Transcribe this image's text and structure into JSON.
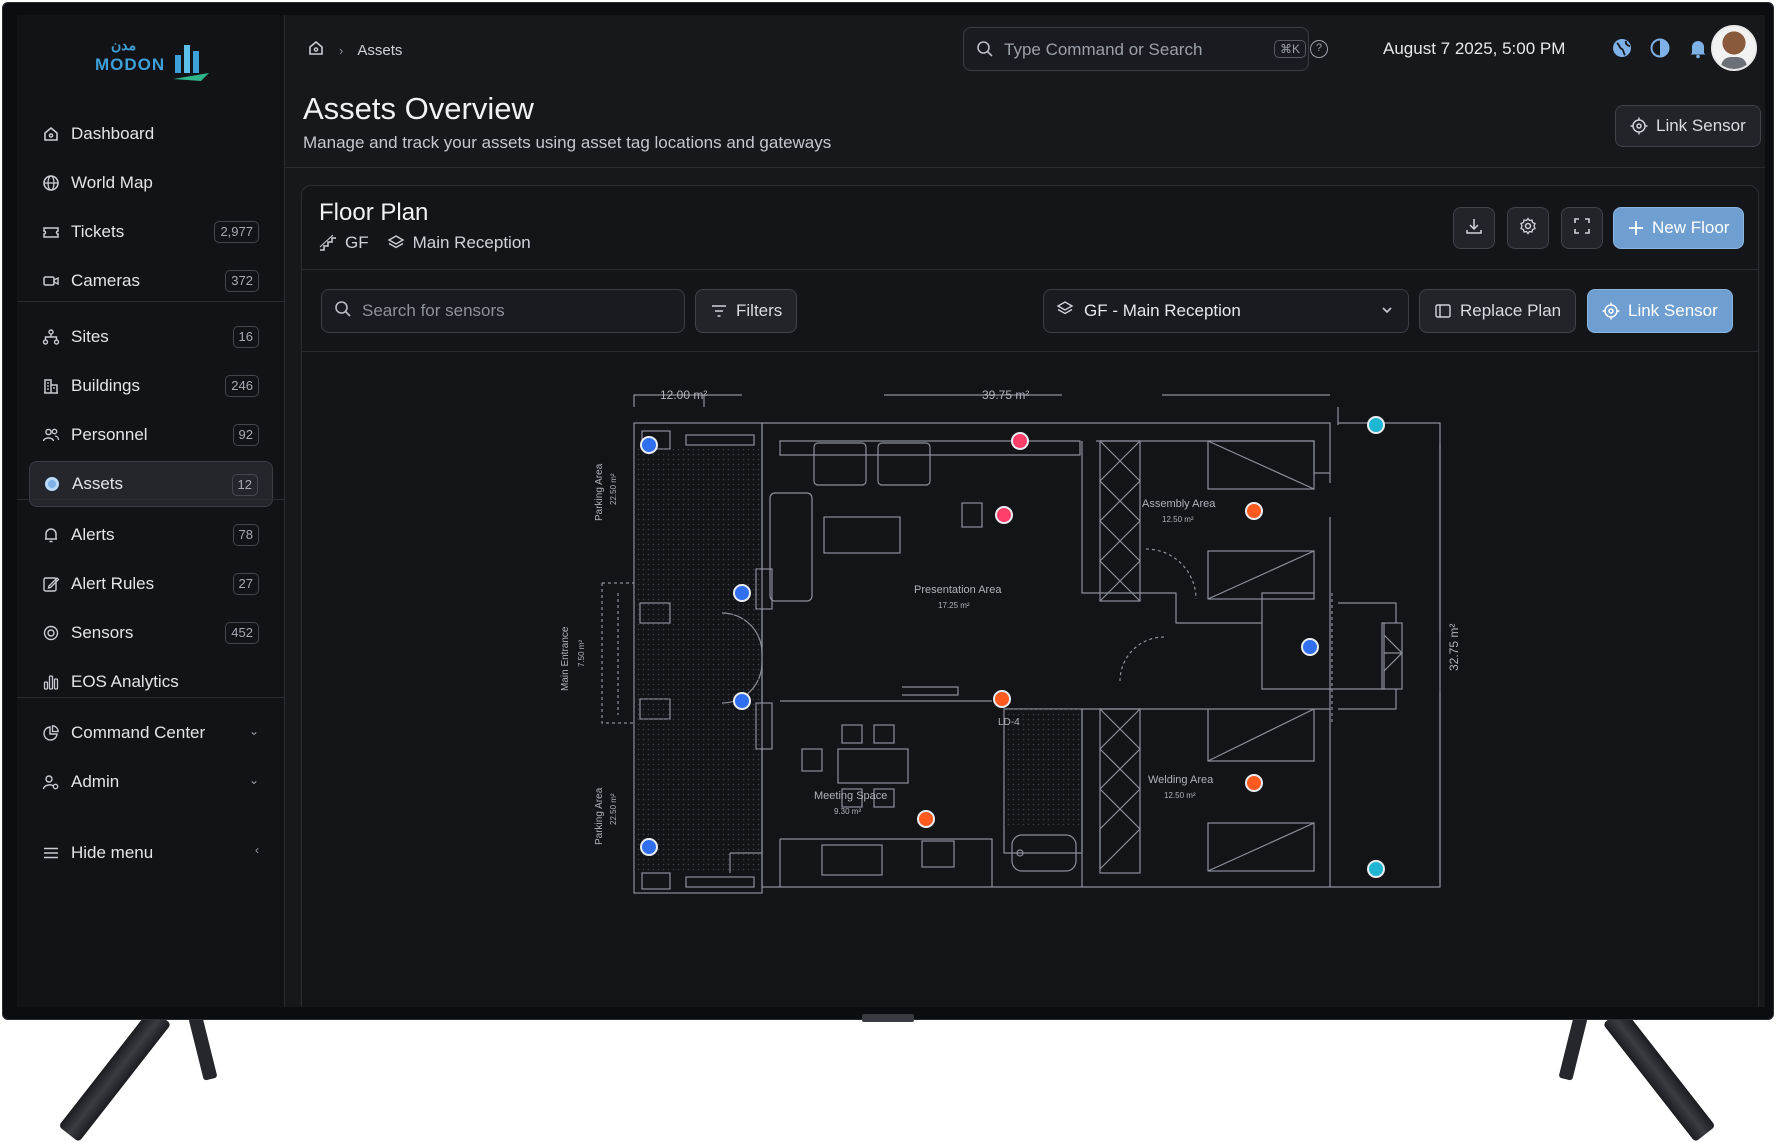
{
  "brand": {
    "arabic": "مدن",
    "name": "MODON"
  },
  "sidebar": {
    "items": [
      {
        "label": "Dashboard",
        "icon": "home-icon"
      },
      {
        "label": "World Map",
        "icon": "globe-icon"
      },
      {
        "label": "Tickets",
        "icon": "ticket-icon",
        "count": "2,977"
      },
      {
        "label": "Cameras",
        "icon": "camera-icon",
        "count": "372"
      },
      {
        "label": "Sites",
        "icon": "sitemap-icon",
        "count": "16"
      },
      {
        "label": "Buildings",
        "icon": "building-icon",
        "count": "246"
      },
      {
        "label": "Personnel",
        "icon": "users-icon",
        "count": "92"
      },
      {
        "label": "Assets",
        "icon": "asset-dot-icon",
        "count": "12",
        "active": true
      },
      {
        "label": "Alerts",
        "icon": "bell-icon",
        "count": "78"
      },
      {
        "label": "Alert Rules",
        "icon": "edit-icon",
        "count": "27"
      },
      {
        "label": "Sensors",
        "icon": "sensor-icon",
        "count": "452"
      },
      {
        "label": "EOS Analytics",
        "icon": "bar-chart-icon"
      },
      {
        "label": "Command Center",
        "icon": "pie-icon"
      },
      {
        "label": "Admin",
        "icon": "user-gear-icon"
      }
    ],
    "hide_menu": "Hide menu"
  },
  "topbar": {
    "breadcrumb": "Assets",
    "search_placeholder": "Type Command or Search",
    "shortcut": "⌘K",
    "help": "?",
    "datetime": "August 7 2025, 5:00 PM"
  },
  "page": {
    "title": "Assets Overview",
    "subtitle": "Manage and track your assets using asset tag locations and gateways",
    "link_sensor": "Link Sensor"
  },
  "floor_plan": {
    "title": "Floor Plan",
    "level": "GF",
    "area": "Main Reception",
    "new_floor": "New Floor",
    "search_placeholder": "Search for sensors",
    "filters": "Filters",
    "floor_select": "GF - Main Reception",
    "replace_plan": "Replace Plan",
    "link_sensor": "Link Sensor"
  },
  "plan_labels": {
    "dim_top_left": "12.00 m²",
    "dim_top_right": "39.75 m²",
    "dim_right": "32.75 m²",
    "parking_top": "Parking Area",
    "parking_top_area": "22.50 m²",
    "parking_bottom": "Parking Area",
    "parking_bottom_area": "22.50 m²",
    "main_entrance": "Main Entrance",
    "main_entrance_area": "7.50 m²",
    "presentation": "Presentation Area",
    "presentation_area": "17.25 m²",
    "assembly": "Assembly Area",
    "assembly_area": "12.50 m²",
    "welding": "Welding Area",
    "welding_area": "12.50 m²",
    "meeting": "Meeting Space",
    "meeting_area": "9.30 m²",
    "ld": "LD-4"
  },
  "colors": {
    "accent": "#6f9fd0",
    "sensor_blue": "#2f6ff0",
    "sensor_red": "#ff5a1f",
    "sensor_pink": "#ff3f6a",
    "sensor_cyan": "#1fb6d4"
  }
}
